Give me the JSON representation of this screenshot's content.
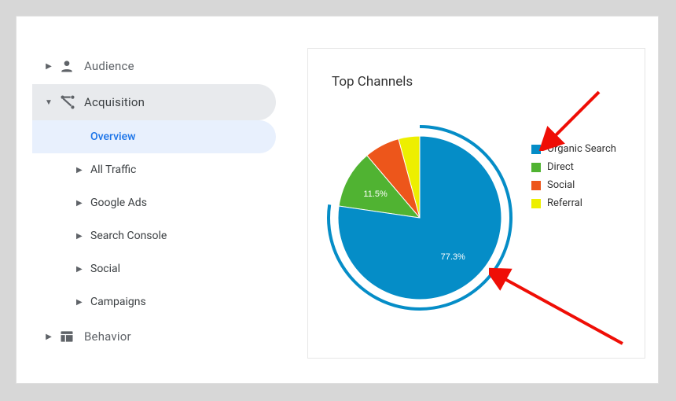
{
  "sidebar": {
    "items": [
      {
        "label": "Audience",
        "icon": "audience"
      },
      {
        "label": "Acquisition",
        "icon": "acquisition",
        "expanded": true,
        "sub": [
          {
            "label": "Overview",
            "selected": true
          },
          {
            "label": "All Traffic",
            "expandable": true
          },
          {
            "label": "Google Ads",
            "expandable": true
          },
          {
            "label": "Search Console",
            "expandable": true
          },
          {
            "label": "Social",
            "expandable": true
          },
          {
            "label": "Campaigns",
            "expandable": true
          }
        ]
      },
      {
        "label": "Behavior",
        "icon": "behavior"
      }
    ]
  },
  "card": {
    "title": "Top Channels"
  },
  "chart_data": {
    "type": "pie",
    "title": "Top Channels",
    "series": [
      {
        "name": "Organic Search",
        "value": 77.3,
        "color": "#058dc7",
        "label": "77.3%"
      },
      {
        "name": "Direct",
        "value": 11.5,
        "color": "#50b332",
        "label": "11.5%"
      },
      {
        "name": "Social",
        "value": 7.0,
        "color": "#ed561b"
      },
      {
        "name": "Referral",
        "value": 4.2,
        "color": "#edef00"
      }
    ]
  }
}
